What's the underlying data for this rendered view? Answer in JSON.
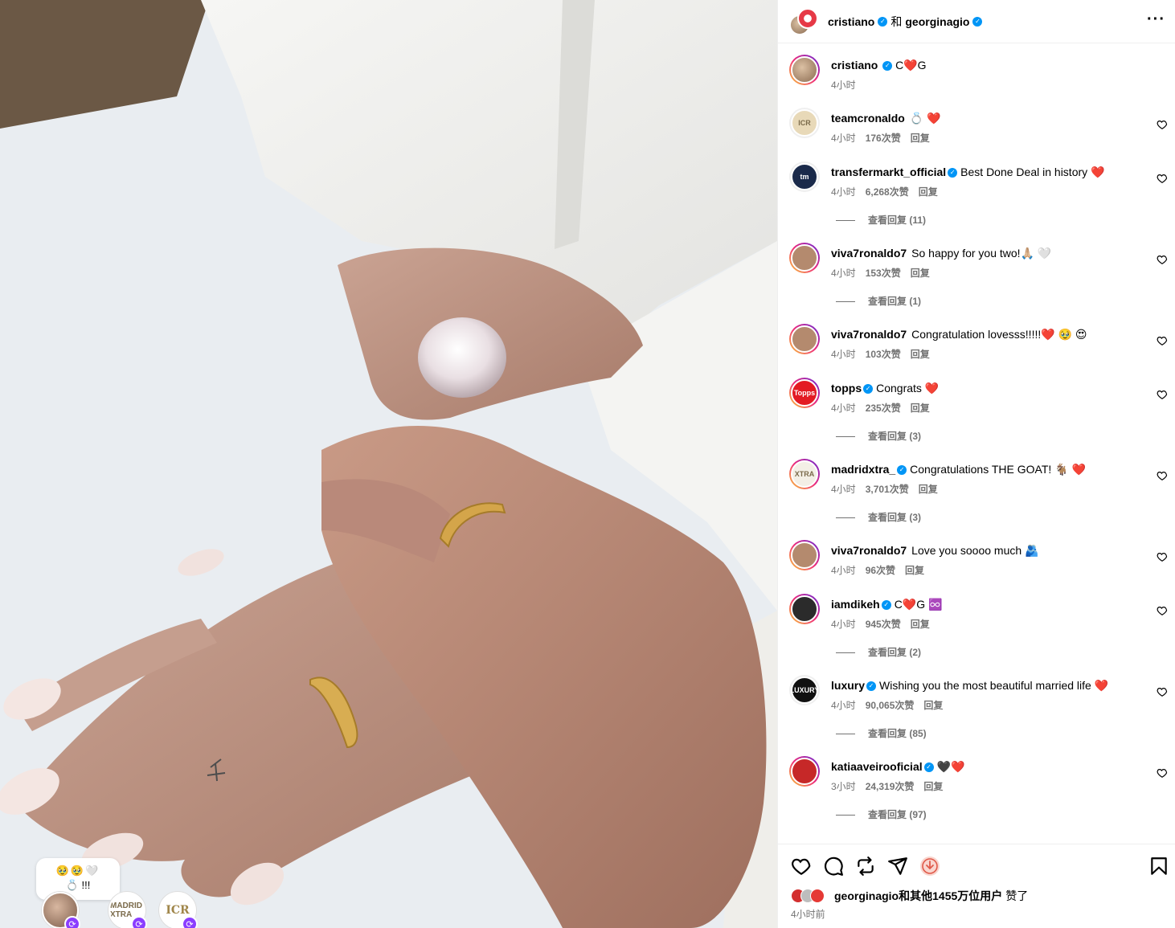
{
  "post": {
    "author": "cristiano",
    "connector": "和",
    "coauthor": "georginagio",
    "caption_user": "cristiano",
    "caption": "C❤️G",
    "caption_time": "4小时"
  },
  "overlay": {
    "bubble_line1": "🥹🥹🤍",
    "bubble_line2": "💍 !!!",
    "friend2_label": "MADRID XTRA",
    "friend3_label": "ICR"
  },
  "comments": [
    {
      "user": "teamcronaldo",
      "verified": false,
      "text": "💍 ❤️",
      "time": "4小时",
      "likes": "176次赞",
      "reply": "回复",
      "view_replies": "",
      "avatar_label": "ICR",
      "avatar_color": "#e8d9b8"
    },
    {
      "user": "transfermarkt_official",
      "verified": true,
      "text": "Best Done Deal in history ❤️",
      "time": "4小时",
      "likes": "6,268次赞",
      "reply": "回复",
      "view_replies": "查看回复 (11)",
      "avatar_label": "tm",
      "avatar_color": "#1a2a4a"
    },
    {
      "user": "viva7ronaldo7",
      "verified": false,
      "text": "So happy for you two!🙏🏼 🤍",
      "time": "4小时",
      "likes": "153次赞",
      "reply": "回复",
      "view_replies": "查看回复 (1)",
      "avatar_label": "",
      "avatar_color": "#b48a6e"
    },
    {
      "user": "viva7ronaldo7",
      "verified": false,
      "text": "Congratulation lovesss!!!!!❤️ 🥹 😍",
      "time": "4小时",
      "likes": "103次赞",
      "reply": "回复",
      "view_replies": "",
      "avatar_label": "",
      "avatar_color": "#b48a6e"
    },
    {
      "user": "topps",
      "verified": true,
      "text": "Congrats ❤️",
      "time": "4小时",
      "likes": "235次赞",
      "reply": "回复",
      "view_replies": "查看回复 (3)",
      "avatar_label": "Topps",
      "avatar_color": "#e31b23"
    },
    {
      "user": "madridxtra_",
      "verified": true,
      "text": "Congratulations THE GOAT! 🐐 ❤️",
      "time": "4小时",
      "likes": "3,701次赞",
      "reply": "回复",
      "view_replies": "查看回复 (3)",
      "avatar_label": "XTRA",
      "avatar_color": "#f3efe6"
    },
    {
      "user": "viva7ronaldo7",
      "verified": false,
      "text": "Love you soooo much 🫂",
      "time": "4小时",
      "likes": "96次赞",
      "reply": "回复",
      "view_replies": "",
      "avatar_label": "",
      "avatar_color": "#b48a6e"
    },
    {
      "user": "iamdikeh",
      "verified": true,
      "text": "C❤️G ♾️",
      "time": "4小时",
      "likes": "945次赞",
      "reply": "回复",
      "view_replies": "查看回复 (2)",
      "avatar_label": "",
      "avatar_color": "#2b2b2b"
    },
    {
      "user": "luxury",
      "verified": true,
      "text": "Wishing you the most beautiful married life ❤️",
      "time": "4小时",
      "likes": "90,065次赞",
      "reply": "回复",
      "view_replies": "查看回复 (85)",
      "avatar_label": "LUXURY",
      "avatar_color": "#111111"
    },
    {
      "user": "katiaaveirooficial",
      "verified": true,
      "text": "🖤❤️",
      "time": "3小时",
      "likes": "24,319次赞",
      "reply": "回复",
      "view_replies": "查看回复 (97)",
      "avatar_label": "",
      "avatar_color": "#c62828"
    }
  ],
  "footer": {
    "liked_by_user": "georginagio",
    "liked_by_rest": "和其他1455万位用户",
    "liked_suffix": "赞了",
    "time_ago": "4小时前"
  },
  "colors": {
    "verified": "#0095f6",
    "secondary_text": "#737373",
    "heart": "#ff3040"
  }
}
